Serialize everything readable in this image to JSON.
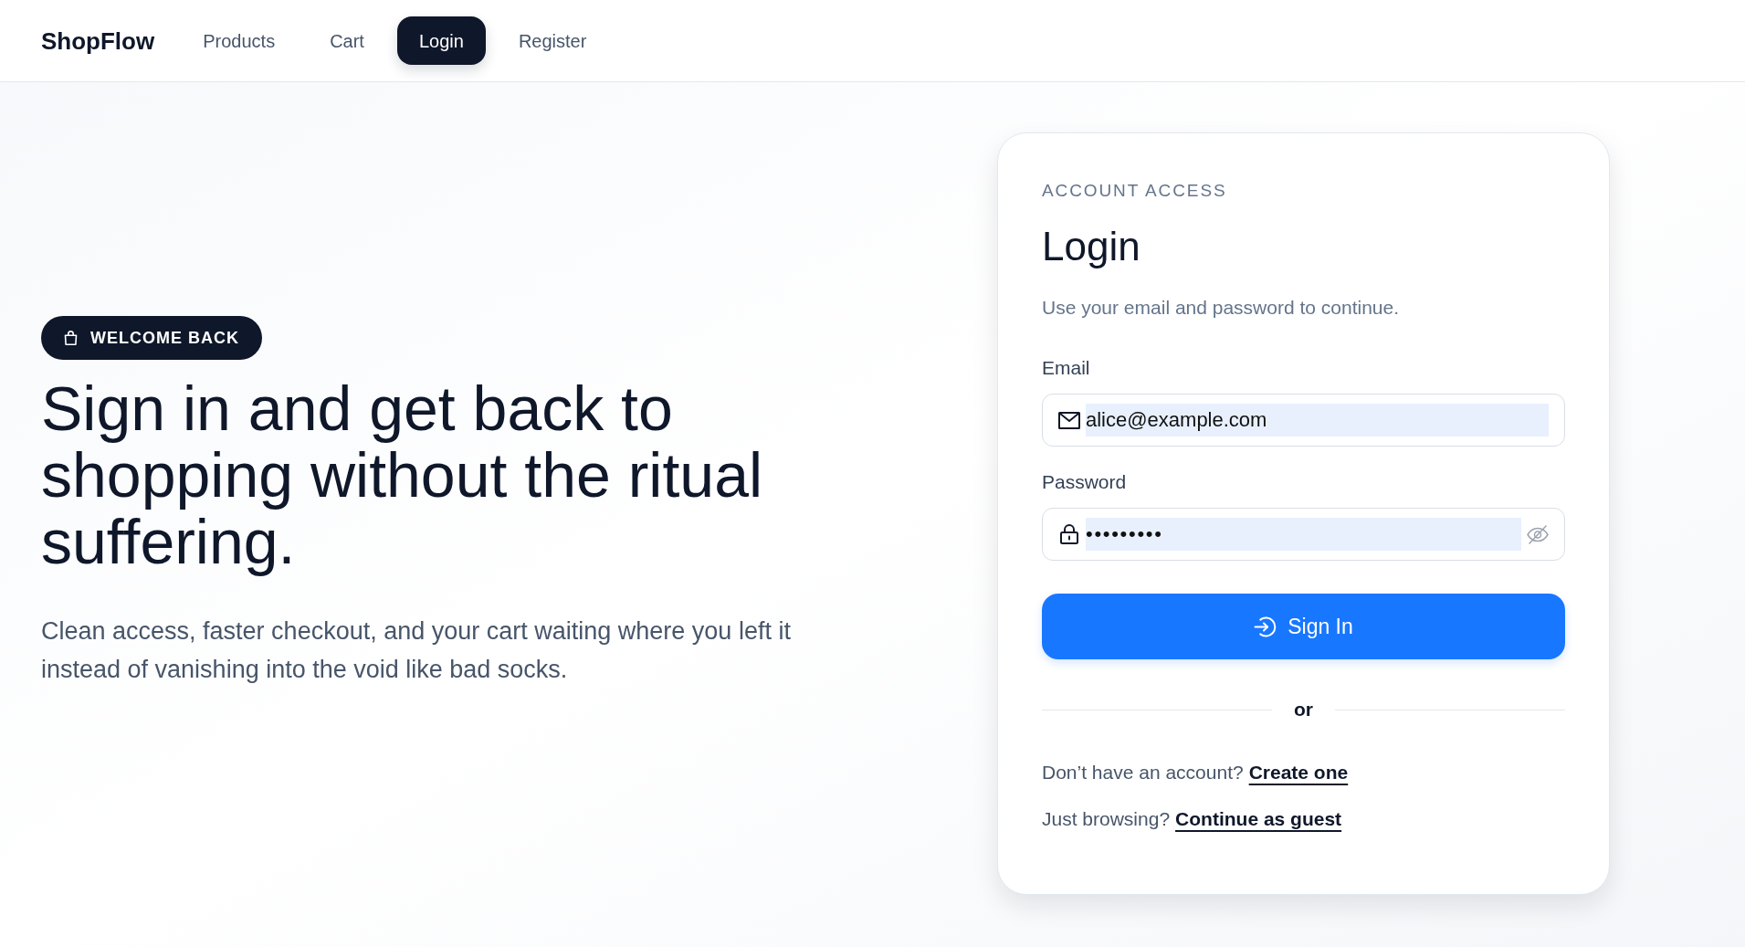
{
  "nav": {
    "logo": "ShopFlow",
    "items": [
      {
        "label": "Products",
        "selected": false
      },
      {
        "label": "Cart",
        "selected": false
      },
      {
        "label": "Login",
        "selected": true
      },
      {
        "label": "Register",
        "selected": false
      }
    ]
  },
  "hero": {
    "badge": "WELCOME BACK",
    "heading": "Sign in and get back to shopping without the ritual suffering.",
    "text": "Clean access, faster checkout, and your cart waiting where you left it instead of vanishing into the void like bad socks."
  },
  "login_card": {
    "eyebrow": "ACCOUNT ACCESS",
    "title": "Login",
    "subtitle": "Use your email and password to continue.",
    "fields": [
      {
        "kind": "email",
        "label": "Email",
        "value": "alice@example.com",
        "autofilled": true
      },
      {
        "kind": "password",
        "label": "Password",
        "value": "•••••••••",
        "autofilled": true
      }
    ],
    "submit": "Sign In",
    "divider": "or",
    "links": [
      {
        "prompt": "Don’t have an account?",
        "link": "Create one"
      },
      {
        "prompt": "Just browsing?",
        "link": "Continue as guest"
      }
    ]
  }
}
